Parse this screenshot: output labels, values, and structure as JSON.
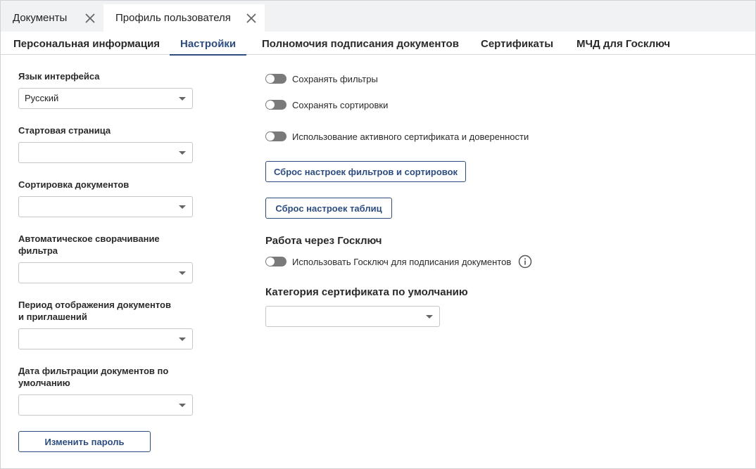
{
  "doc_tabs": [
    {
      "label": "Документы"
    },
    {
      "label": "Профиль пользователя"
    }
  ],
  "section_tabs": [
    {
      "label": "Персональная информация"
    },
    {
      "label": "Настройки"
    },
    {
      "label": "Полномочия подписания документов"
    },
    {
      "label": "Сертификаты"
    },
    {
      "label": "МЧД для Госключ"
    }
  ],
  "active_section_tab": "Настройки",
  "left": {
    "language": {
      "label": "Язык интерфейса",
      "value": "Русский"
    },
    "start_page": {
      "label": "Стартовая страница",
      "value": ""
    },
    "doc_sort": {
      "label": "Сортировка документов",
      "value": ""
    },
    "auto_collapse": {
      "label": "Автоматическое сворачивание фильтра",
      "value": ""
    },
    "period": {
      "label_line1": "Период отображения документов",
      "label_line2": "и приглашений",
      "value": ""
    },
    "filter_date": {
      "label": "Дата фильтрации документов по умолчанию",
      "value": ""
    },
    "change_password": "Изменить пароль"
  },
  "right": {
    "save_filters": "Сохранять фильтры",
    "save_sorting": "Сохранять сортировки",
    "use_active_cert": "Использование активного сертификата и доверенности",
    "reset_filters_btn": "Сброс настроек фильтров и сортировок",
    "reset_tables_btn": "Сброс настроек таблиц",
    "goskey_title": "Работа через Госключ",
    "use_goskey": "Использовать Госключ для подписания документов",
    "cert_category_title": "Категория сертификата по умолчанию",
    "cert_category_value": ""
  },
  "toggles": {
    "save_filters": false,
    "save_sorting": false,
    "use_active_cert": false,
    "use_goskey": false
  },
  "colors": {
    "accent": "#2d4d80",
    "toggle_off": "#7a7a7a"
  }
}
